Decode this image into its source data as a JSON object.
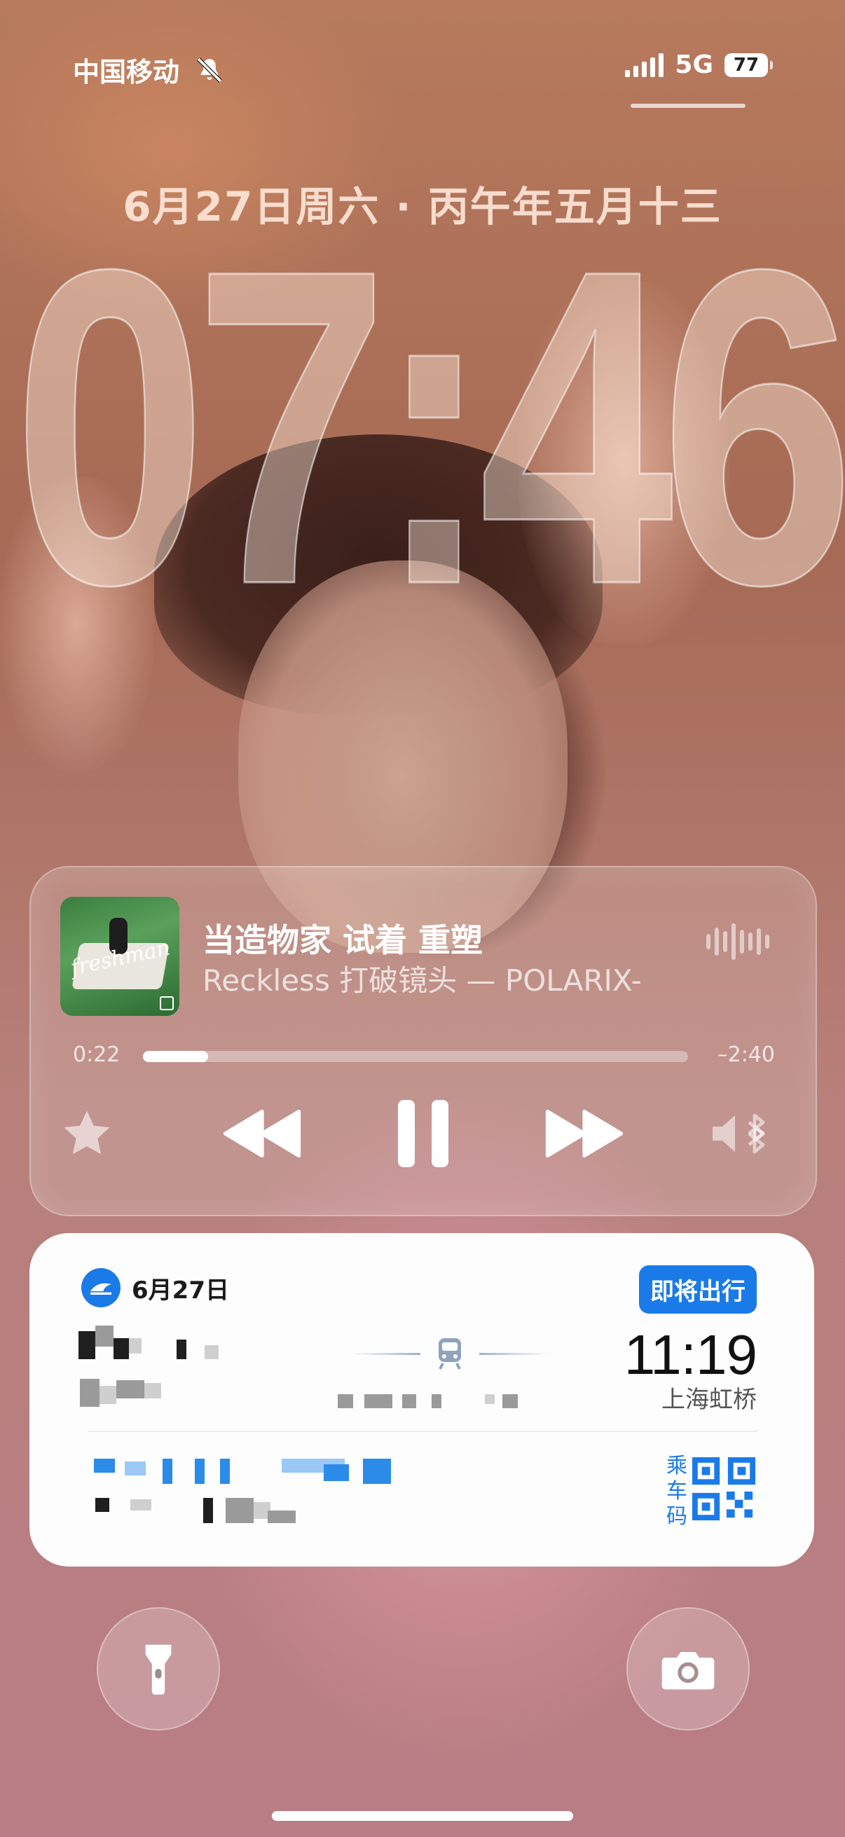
{
  "status_bar": {
    "carrier": "中国移动",
    "network": "5G",
    "battery": "77",
    "icons": [
      "bell-slash-icon",
      "cellular-signal-icon",
      "battery-icon"
    ]
  },
  "lock_screen": {
    "date": "6月27日周六 · 丙午年五月十三",
    "time": "07:46"
  },
  "now_playing": {
    "title": "当造物家 试着 重塑",
    "subtitle": "Reckless 打破镜头 — POLARIX-",
    "album_art_text": "freshman",
    "elapsed": "0:22",
    "remaining": "–2:40",
    "progress": 0.12,
    "controls": [
      "star-icon",
      "rewind-icon",
      "pause-icon",
      "fast-forward-icon",
      "speaker-bluetooth-icon"
    ]
  },
  "trip_card": {
    "date": "6月27日",
    "badge": "即将出行",
    "arrival_time": "11:19",
    "arrival_station": "上海虹桥",
    "ride_code_label": "乘车码",
    "accent_color": "#1a7be8"
  },
  "bottom_actions": [
    "flashlight-icon",
    "camera-icon"
  ]
}
